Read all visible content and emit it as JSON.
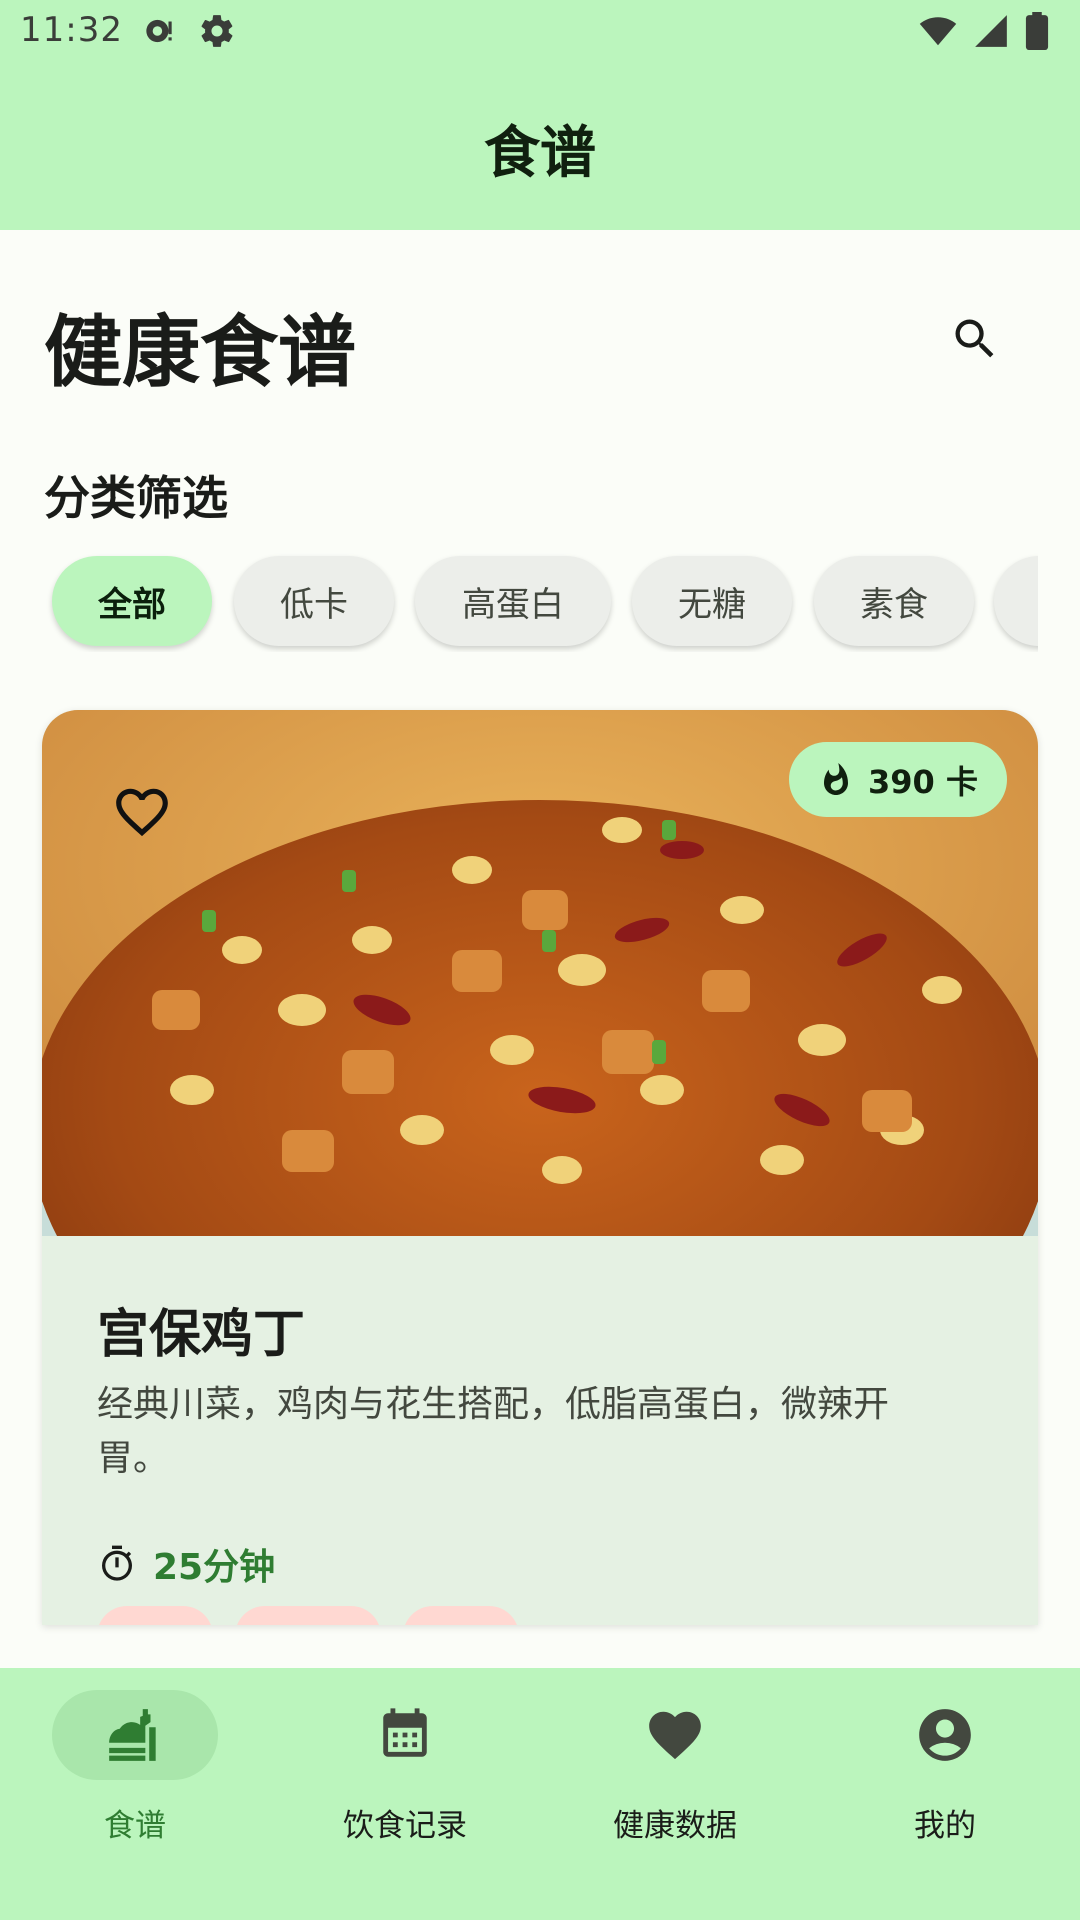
{
  "status_bar": {
    "time": "11:32"
  },
  "app_bar": {
    "title": "食谱"
  },
  "page": {
    "title": "健康食谱",
    "filter_heading": "分类筛选"
  },
  "filters": {
    "chips": [
      {
        "label": "全部",
        "selected": true
      },
      {
        "label": "低卡",
        "selected": false
      },
      {
        "label": "高蛋白",
        "selected": false
      },
      {
        "label": "无糖",
        "selected": false
      },
      {
        "label": "素食",
        "selected": false
      },
      {
        "label": "",
        "selected": false
      }
    ]
  },
  "recipe": {
    "name": "宫保鸡丁",
    "description": "经典川菜，鸡肉与花生搭配，低脂高蛋白，微辣开胃。",
    "calories": "390 卡",
    "time": "25分钟",
    "favorite": false,
    "image_icon": "dish-photo"
  },
  "bottom_nav": {
    "items": [
      {
        "label": "食谱",
        "icon": "recipe-icon",
        "active": true
      },
      {
        "label": "饮食记录",
        "icon": "calendar-icon",
        "active": false
      },
      {
        "label": "健康数据",
        "icon": "heart-icon",
        "active": false
      },
      {
        "label": "我的",
        "icon": "account-icon",
        "active": false
      }
    ]
  },
  "colors": {
    "primary_container": "#bbf5bd",
    "accent_text": "#2f7d32",
    "card_surface": "#e5f1e3",
    "chip_surface": "#eceeea"
  }
}
